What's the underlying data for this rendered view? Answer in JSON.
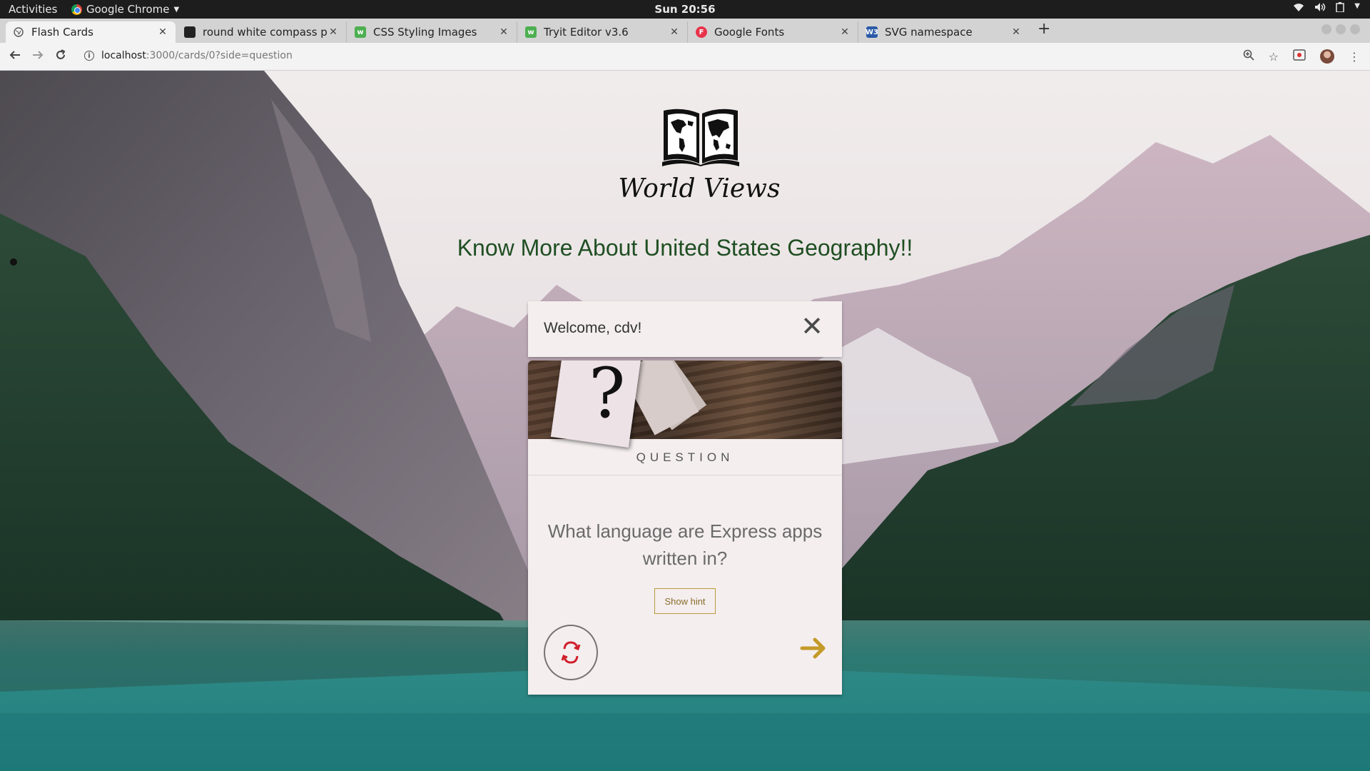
{
  "os": {
    "activities_label": "Activities",
    "app_name": "Google Chrome",
    "clock": "Sun 20:56"
  },
  "tabs": [
    {
      "title": "Flash Cards",
      "icon": "globe-icon",
      "active": true
    },
    {
      "title": "round white compass pho",
      "icon": "unsplash-icon"
    },
    {
      "title": "CSS Styling Images",
      "icon": "w3schools-icon"
    },
    {
      "title": "Tryit Editor v3.6",
      "icon": "w3schools-icon"
    },
    {
      "title": "Google Fonts",
      "icon": "google-fonts-icon"
    },
    {
      "title": "SVG namespace",
      "icon": "w3c-icon"
    }
  ],
  "address": {
    "host": "localhost",
    "path": ":3000/cards/0?side=question"
  },
  "page": {
    "brand": "World Views",
    "headline": "Know More About United States Geography!!",
    "welcome": "Welcome, cdv!",
    "close_symbol": "✕",
    "side_label": "QUESTION",
    "question": "What language are Express apps written in?",
    "hint_button": "Show hint",
    "qmark": "?"
  },
  "colors": {
    "headline": "#1f4f22",
    "card_bg": "#f4eeef",
    "hint_border": "#b89a3a",
    "arrow": "#c49a28",
    "flip_icon": "#d0212d"
  }
}
